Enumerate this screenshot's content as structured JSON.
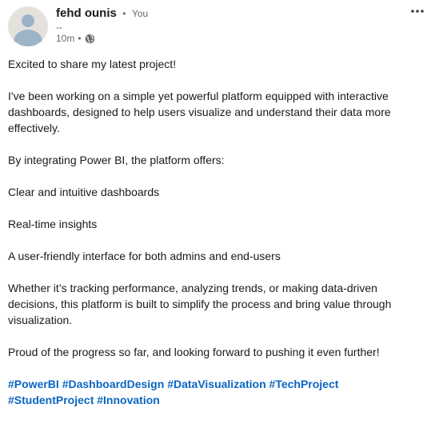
{
  "post": {
    "author": {
      "name": "fehd ounis",
      "relation_separator": "•",
      "relation": "You",
      "headline": "--",
      "time": "10m",
      "visibility_icon": "globe-icon"
    },
    "more_icon": "more-horizontal-icon",
    "paragraphs": [
      "Excited to share my latest project!",
      "I've been working on a simple yet powerful platform equipped with interactive dashboards, designed to help users visualize and understand their data more effectively.",
      "By integrating Power BI, the platform offers:",
      "Clear and intuitive dashboards",
      "Real-time insights",
      "A user-friendly interface for both admins and end-users",
      "Whether it’s tracking performance, analyzing trends, or making data-driven decisions, this platform is built to simplify the process and bring value through visualization.",
      "Proud of the progress so far, and looking forward to pushing it even further!"
    ],
    "hashtags": [
      "#PowerBI",
      "#DashboardDesign",
      "#DataVisualization",
      "#TechProject",
      "#StudentProject",
      "#Innovation"
    ],
    "colors": {
      "link": "#0a66c2",
      "text": "#191919",
      "muted": "#666666"
    }
  }
}
